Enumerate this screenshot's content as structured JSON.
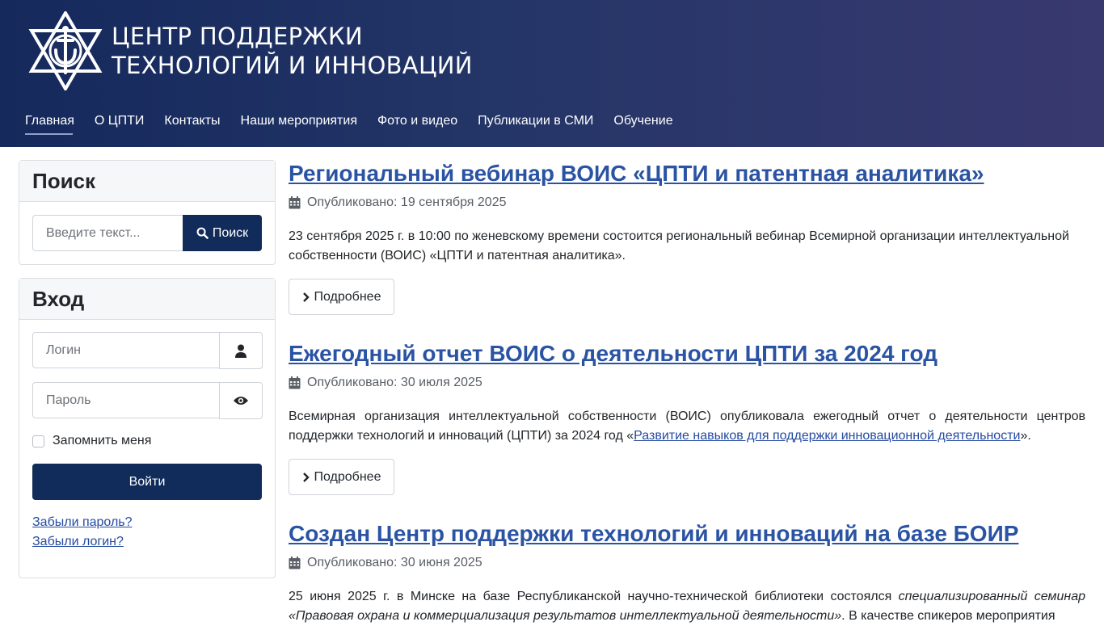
{
  "header": {
    "title_line1": "ЦЕНТР ПОДДЕРЖКИ",
    "title_line2": "ТЕХНОЛОГИЙ И ИННОВАЦИЙ",
    "logo_icon": "ctti-star-logo-icon"
  },
  "nav": {
    "items": [
      {
        "label": "Главная"
      },
      {
        "label": "О ЦПТИ"
      },
      {
        "label": "Контакты"
      },
      {
        "label": "Наши мероприятия"
      },
      {
        "label": "Фото и видео"
      },
      {
        "label": "Публикации в СМИ"
      },
      {
        "label": "Обучение"
      }
    ]
  },
  "search": {
    "title": "Поиск",
    "placeholder": "Введите текст...",
    "button": "Поиск"
  },
  "login": {
    "title": "Вход",
    "username_placeholder": "Логин",
    "password_placeholder": "Пароль",
    "remember": "Запомнить меня",
    "submit": "Войти",
    "forgot_password": "Забыли пароль?",
    "forgot_login": "Забыли логин?"
  },
  "articles": [
    {
      "title": "Региональный вебинар ВОИС «ЦПТИ и патентная аналитика»",
      "published": "Опубликовано: 19 сентября 2025",
      "text": "23 сентября 2025 г. в 10:00 по женевскому времени состоится региональный вебинар Всемирной организации интеллектуальной собственности (ВОИС) «ЦПТИ и патентная аналитика».",
      "more": "Подробнее"
    },
    {
      "title": "Ежегодный отчет ВОИС о деятельности ЦПТИ за 2024 год",
      "published": "Опубликовано: 30 июля 2025",
      "text_before": "Всемирная организация интеллектуальной собственности (ВОИС) опубликовала ежегодный отчет о деятельности центров поддержки технологий и инноваций (ЦПТИ) за 2024 год «",
      "link": "Развитие навыков для поддержки инновационной деятельности",
      "text_after": "».",
      "more": "Подробнее"
    },
    {
      "title": "Создан Центр поддержки технологий и инноваций на базе БОИР",
      "published": "Опубликовано: 30 июня 2025",
      "text_before": "25 июня 2025 г. в Минске на базе Республиканской научно-технической библиотеки состоялся ",
      "text_italic": "специализированный семинар «Правовая охрана и коммерциализация результатов интеллектуальной деятельности»",
      "text_after": ". В качестве спикеров мероприятия"
    }
  ]
}
